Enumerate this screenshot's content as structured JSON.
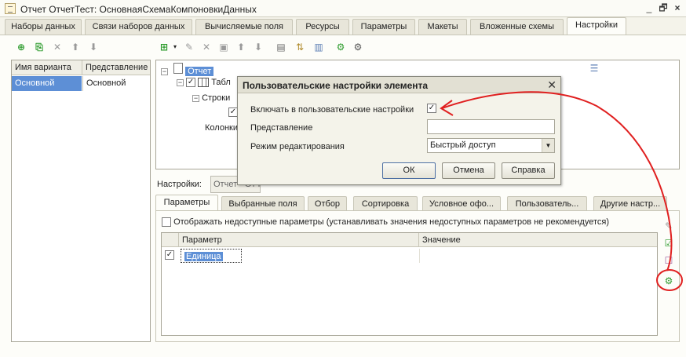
{
  "window": {
    "title": "Отчет ОтчетТест: ОсновнаяСхемаКомпоновкиДанных",
    "controls": [
      "_",
      "🗗",
      "×"
    ]
  },
  "top_tabs": [
    {
      "label": "Наборы данных"
    },
    {
      "label": "Связи наборов данных"
    },
    {
      "label": "Вычисляемые поля"
    },
    {
      "label": "Ресурсы"
    },
    {
      "label": "Параметры"
    },
    {
      "label": "Макеты"
    },
    {
      "label": "Вложенные схемы"
    },
    {
      "label": "Настройки",
      "active": true
    }
  ],
  "variants": {
    "headers": [
      "Имя варианта",
      "Представление"
    ],
    "rows": [
      {
        "name": "Основной",
        "presentation": "Основной"
      }
    ]
  },
  "tree": {
    "root": "Отчет",
    "table": "Табл",
    "rows": "Строки",
    "columns": "Колонки"
  },
  "settings": {
    "label": "Настройки:",
    "field_value": "Отчет - Отчет"
  },
  "bottom_tabs": [
    {
      "label": "Параметры",
      "active": true
    },
    {
      "label": "Выбранные поля"
    },
    {
      "label": "Отбор"
    },
    {
      "label": "Сортировка"
    },
    {
      "label": "Условное офо..."
    },
    {
      "label": "Пользователь..."
    },
    {
      "label": "Другие настр..."
    }
  ],
  "parameters": {
    "show_unavailable": "Отображать недоступные параметры (устанавливать значения недоступных параметров не рекомендуется)",
    "headers": [
      "Параметр",
      "Значение"
    ],
    "rows": [
      {
        "checked": true,
        "name": "Единица",
        "value": ""
      }
    ]
  },
  "dialog": {
    "title": "Пользовательские настройки элемента",
    "include_label": "Включать в пользовательские настройки",
    "include_checked": true,
    "presentation_label": "Представление",
    "presentation_value": "",
    "mode_label": "Режим редактирования",
    "mode_value": "Быстрый доступ",
    "ok": "ОК",
    "cancel": "Отмена",
    "help": "Справка"
  },
  "colors": {
    "selection": "#5d8fd6",
    "annotation": "#e02020"
  }
}
